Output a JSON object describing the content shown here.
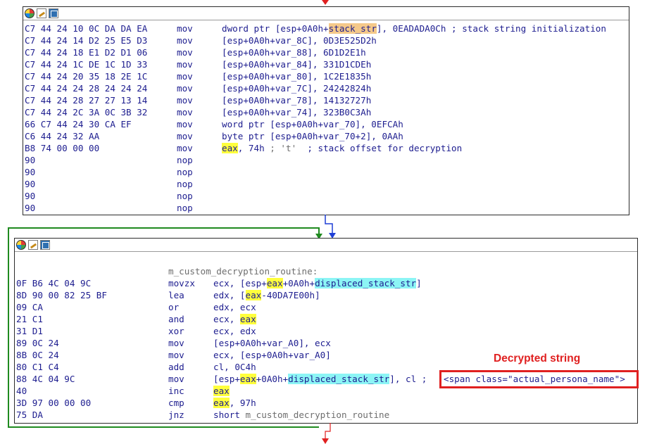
{
  "block1": {
    "rows": [
      {
        "bytes": "C7 44 24 10 0C DA DA EA",
        "mnemonic": "mov",
        "operands": [
          {
            "t": "dword ptr [esp+0A0h+"
          },
          {
            "t": "stack_str",
            "hl": "o"
          },
          {
            "t": "], 0EADADA0Ch ; stack string initialization"
          }
        ]
      },
      {
        "bytes": "C7 44 24 14 D2 25 E5 D3",
        "mnemonic": "mov",
        "operands": [
          {
            "t": "[esp+0A0h+var_8C], 0D3E525D2h"
          }
        ]
      },
      {
        "bytes": "C7 44 24 18 E1 D2 D1 06",
        "mnemonic": "mov",
        "operands": [
          {
            "t": "[esp+0A0h+var_88], 6D1D2E1h"
          }
        ]
      },
      {
        "bytes": "C7 44 24 1C DE 1C 1D 33",
        "mnemonic": "mov",
        "operands": [
          {
            "t": "[esp+0A0h+var_84], 331D1CDEh"
          }
        ]
      },
      {
        "bytes": "C7 44 24 20 35 18 2E 1C",
        "mnemonic": "mov",
        "operands": [
          {
            "t": "[esp+0A0h+var_80], 1C2E1835h"
          }
        ]
      },
      {
        "bytes": "C7 44 24 24 28 24 24 24",
        "mnemonic": "mov",
        "operands": [
          {
            "t": "[esp+0A0h+var_7C], 24242824h"
          }
        ]
      },
      {
        "bytes": "C7 44 24 28 27 27 13 14",
        "mnemonic": "mov",
        "operands": [
          {
            "t": "[esp+0A0h+var_78], 14132727h"
          }
        ]
      },
      {
        "bytes": "C7 44 24 2C 3A 0C 3B 32",
        "mnemonic": "mov",
        "operands": [
          {
            "t": "[esp+0A0h+var_74], 323B0C3Ah"
          }
        ]
      },
      {
        "bytes": "66 C7 44 24 30 CA EF",
        "mnemonic": "mov",
        "operands": [
          {
            "t": "word ptr [esp+0A0h+var_70], 0EFCAh"
          }
        ]
      },
      {
        "bytes": "C6 44 24 32 AA",
        "mnemonic": "mov",
        "operands": [
          {
            "t": "byte ptr [esp+0A0h+var_70+2], 0AAh"
          }
        ]
      },
      {
        "bytes": "B8 74 00 00 00",
        "mnemonic": "mov",
        "operands": [
          {
            "t": "eax",
            "hl": "y"
          },
          {
            "t": ", 74h "
          },
          {
            "t": "; 't'",
            "c": "gray"
          },
          {
            "t": "  ; stack offset for decryption"
          }
        ]
      },
      {
        "bytes": "90",
        "mnemonic": "nop",
        "operands": []
      },
      {
        "bytes": "90",
        "mnemonic": "nop",
        "operands": []
      },
      {
        "bytes": "90",
        "mnemonic": "nop",
        "operands": []
      },
      {
        "bytes": "90",
        "mnemonic": "nop",
        "operands": []
      },
      {
        "bytes": "90",
        "mnemonic": "nop",
        "operands": []
      }
    ]
  },
  "block2": {
    "label": "m_custom_decryption_routine:",
    "rows": [
      {
        "bytes": "0F B6 4C 04 9C",
        "mnemonic": "movzx",
        "operands": [
          {
            "t": "ecx, [esp+"
          },
          {
            "t": "eax",
            "hl": "y"
          },
          {
            "t": "+0A0h+"
          },
          {
            "t": "displaced_stack_str",
            "hl": "c"
          },
          {
            "t": "]"
          }
        ]
      },
      {
        "bytes": "8D 90 00 82 25 BF",
        "mnemonic": "lea",
        "operands": [
          {
            "t": "edx, ["
          },
          {
            "t": "eax",
            "hl": "y"
          },
          {
            "t": "-40DA7E00h]"
          }
        ]
      },
      {
        "bytes": "09 CA",
        "mnemonic": "or",
        "operands": [
          {
            "t": "edx, ecx"
          }
        ]
      },
      {
        "bytes": "21 C1",
        "mnemonic": "and",
        "operands": [
          {
            "t": "ecx, "
          },
          {
            "t": "eax",
            "hl": "y"
          }
        ]
      },
      {
        "bytes": "31 D1",
        "mnemonic": "xor",
        "operands": [
          {
            "t": "ecx, edx"
          }
        ]
      },
      {
        "bytes": "89 0C 24",
        "mnemonic": "mov",
        "operands": [
          {
            "t": "[esp+0A0h+var_A0], ecx"
          }
        ]
      },
      {
        "bytes": "8B 0C 24",
        "mnemonic": "mov",
        "operands": [
          {
            "t": "ecx, [esp+0A0h+var_A0]"
          }
        ]
      },
      {
        "bytes": "80 C1 C4",
        "mnemonic": "add",
        "operands": [
          {
            "t": "cl, 0C4h"
          }
        ]
      },
      {
        "bytes": "88 4C 04 9C",
        "mnemonic": "mov",
        "operands": [
          {
            "t": "[esp+"
          },
          {
            "t": "eax",
            "hl": "y"
          },
          {
            "t": "+0A0h+"
          },
          {
            "t": "displaced_stack_str",
            "hl": "c"
          },
          {
            "t": "], cl ;"
          }
        ]
      },
      {
        "bytes": "40",
        "mnemonic": "inc",
        "operands": [
          {
            "t": "eax",
            "hl": "y"
          }
        ]
      },
      {
        "bytes": "3D 97 00 00 00",
        "mnemonic": "cmp",
        "operands": [
          {
            "t": "eax",
            "hl": "y"
          },
          {
            "t": ", 97h"
          }
        ]
      },
      {
        "bytes": "75 DA",
        "mnemonic": "jnz",
        "operands": [
          {
            "t": "short "
          },
          {
            "t": "m_custom_decryption_routine",
            "c": "gray"
          }
        ]
      }
    ]
  },
  "annotation": {
    "title": "Decrypted string",
    "comment": "<span class=\"actual_persona_name\">"
  },
  "colors": {
    "true_edge": "#1f8a1f",
    "flow_edge": "#1f3fd6",
    "exit_edge": "#e02020",
    "annotation": "#e02020"
  }
}
